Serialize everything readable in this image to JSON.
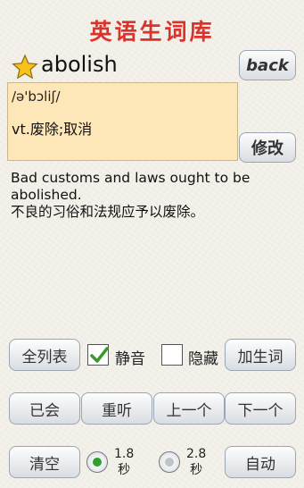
{
  "app": {
    "title": "英语生词库"
  },
  "word": {
    "text": "abolish",
    "phonetic": "/ə'bɔliʃ/",
    "meaning": "vt.废除;取消",
    "example_en_line1": "Bad customs and laws ought to be",
    "example_en_line2": "abolished.",
    "example_cn": "不良的习俗和法规应予以废除。"
  },
  "buttons": {
    "back": "back",
    "edit": "修改",
    "full_list": "全列表",
    "add_word": "加生词",
    "known": "已会",
    "replay": "重听",
    "prev": "上一个",
    "next": "下一个",
    "clear": "清空",
    "auto": "自动"
  },
  "options": {
    "mute_label": "静音",
    "mute_checked": true,
    "hide_label": "隐藏",
    "hide_checked": false,
    "interval1_value": "1.8",
    "interval1_unit": "秒",
    "interval1_selected": true,
    "interval2_value": "2.8",
    "interval2_unit": "秒",
    "interval2_selected": false
  },
  "colors": {
    "title": "#d9342c",
    "card_bg": "#fde6b8",
    "check": "#3a9a2a",
    "radio_selected": "#2e9e2e"
  }
}
